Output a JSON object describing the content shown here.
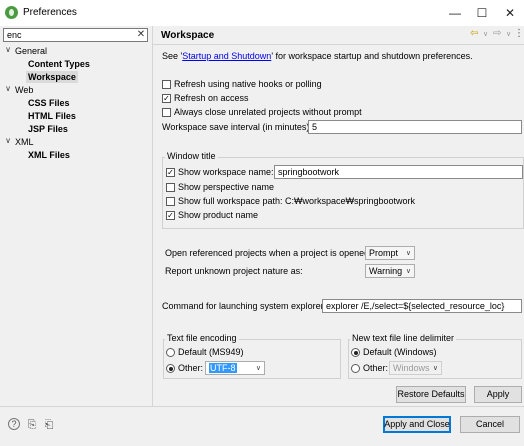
{
  "window": {
    "title": "Preferences"
  },
  "sidebar": {
    "filter_value": "enc",
    "tree": [
      {
        "label": "General",
        "children": [
          "Content Types",
          "Workspace"
        ]
      },
      {
        "label": "Web",
        "children": [
          "CSS Files",
          "HTML Files",
          "JSP Files"
        ]
      },
      {
        "label": "XML",
        "children": [
          "XML Files"
        ]
      }
    ],
    "selected": "Workspace"
  },
  "page": {
    "title": "Workspace",
    "description_prefix": "See '",
    "description_link": "Startup and Shutdown",
    "description_suffix": "' for workspace startup and shutdown preferences.",
    "options": {
      "refresh_native": {
        "label": "Refresh using native hooks or polling",
        "checked": false
      },
      "refresh_access": {
        "label": "Refresh on access",
        "checked": true
      },
      "always_close": {
        "label": "Always close unrelated projects without prompt",
        "checked": false
      }
    },
    "save_interval_label": "Workspace save interval (in minutes):",
    "save_interval_value": "5",
    "window_title": {
      "legend": "Window title",
      "show_workspace_name": {
        "label": "Show workspace name:",
        "checked": true,
        "value": "springbootwork"
      },
      "show_perspective_name": {
        "label": "Show perspective name",
        "checked": false
      },
      "show_full_path": {
        "label": "Show full workspace path:",
        "checked": false,
        "value": "C:₩workspace₩springbootwork"
      },
      "show_product_name": {
        "label": "Show product name",
        "checked": true
      }
    },
    "open_referenced_label": "Open referenced projects when a project is opened:",
    "open_referenced_value": "Prompt",
    "report_unknown_label": "Report unknown project nature as:",
    "report_unknown_value": "Warning",
    "command_label": "Command for launching system explorer:",
    "command_value": "explorer /E,/select=${selected_resource_loc}",
    "text_encoding": {
      "legend": "Text file encoding",
      "default_label": "Default (MS949)",
      "other_label": "Other:",
      "other_value": "UTF-8",
      "selected": "other"
    },
    "line_delimiter": {
      "legend": "New text file line delimiter",
      "default_label": "Default (Windows)",
      "other_label": "Other:",
      "other_value": "Windows",
      "selected": "default"
    },
    "restore_defaults_label": "Restore Defaults",
    "apply_label": "Apply"
  },
  "footer": {
    "apply_close_label": "Apply and Close",
    "cancel_label": "Cancel"
  },
  "icons": {
    "minimize": "—",
    "maximize": "☐",
    "close": "✕",
    "clear": "✕",
    "expand": "∨",
    "back": "⇦",
    "forward": "⇨",
    "menu": "⋮",
    "help": "?",
    "import": "⎘",
    "export": "⎗",
    "check": "✓",
    "dropdown": "∨"
  }
}
